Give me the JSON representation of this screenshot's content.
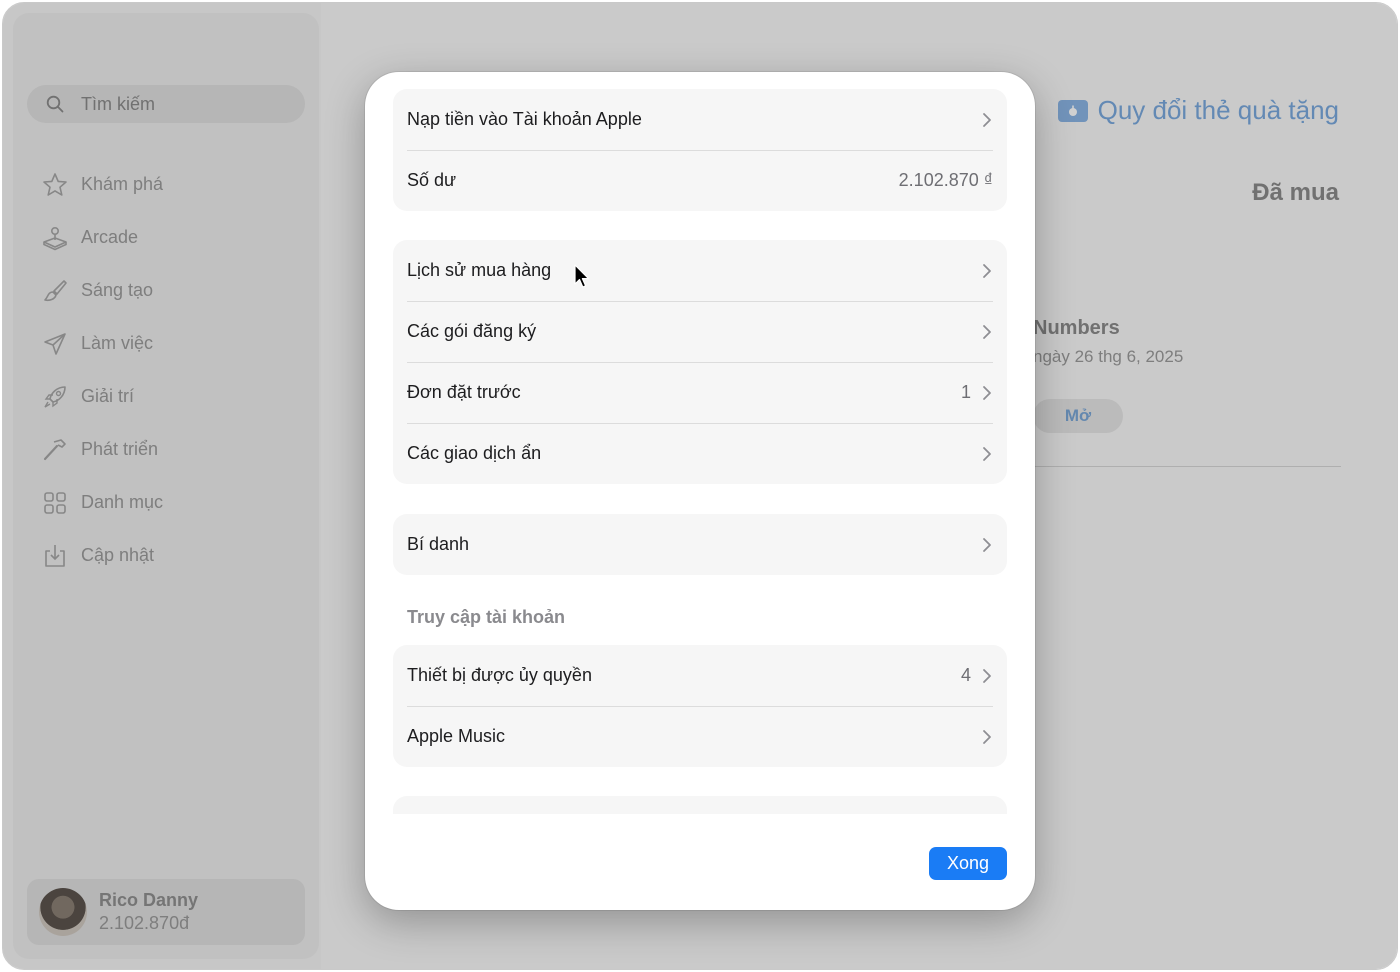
{
  "sidebar": {
    "search_placeholder": "Tìm kiếm",
    "items": [
      {
        "label": "Khám phá",
        "icon": "star-icon"
      },
      {
        "label": "Arcade",
        "icon": "joystick-icon"
      },
      {
        "label": "Sáng tạo",
        "icon": "brush-icon"
      },
      {
        "label": "Làm việc",
        "icon": "paper-plane-icon"
      },
      {
        "label": "Giải trí",
        "icon": "rocket-icon"
      },
      {
        "label": "Phát triển",
        "icon": "hammer-icon"
      },
      {
        "label": "Danh mục",
        "icon": "grid-icon"
      },
      {
        "label": "Cập nhật",
        "icon": "download-icon"
      }
    ],
    "account": {
      "name": "Rico Danny",
      "balance": "2.102.870đ"
    }
  },
  "main": {
    "redeem_label": "Quy đổi thẻ quà tặng",
    "purchased_title": "Đã mua",
    "app": {
      "name": "Numbers",
      "date": "ngày 26 thg 6, 2025",
      "open_label": "Mở"
    }
  },
  "sheet": {
    "group1": [
      {
        "label": "Nạp tiền vào Tài khoản Apple",
        "value": ""
      },
      {
        "label": "Số dư",
        "value": "2.102.870 ₫"
      }
    ],
    "group2": [
      {
        "label": "Lịch sử mua hàng",
        "value": ""
      },
      {
        "label": "Các gói đăng ký",
        "value": ""
      },
      {
        "label": "Đơn đặt trước",
        "value": "1"
      },
      {
        "label": "Các giao dịch ẩn",
        "value": ""
      }
    ],
    "group3": [
      {
        "label": "Bí danh",
        "value": ""
      }
    ],
    "section_title": "Truy cập tài khoản",
    "group4": [
      {
        "label": "Thiết bị được ủy quyền",
        "value": "4"
      },
      {
        "label": "Apple Music",
        "value": ""
      }
    ],
    "done_label": "Xong"
  },
  "colors": {
    "accent": "#1a7cf5",
    "yellow": "#febc2e",
    "green": "#28c840"
  }
}
